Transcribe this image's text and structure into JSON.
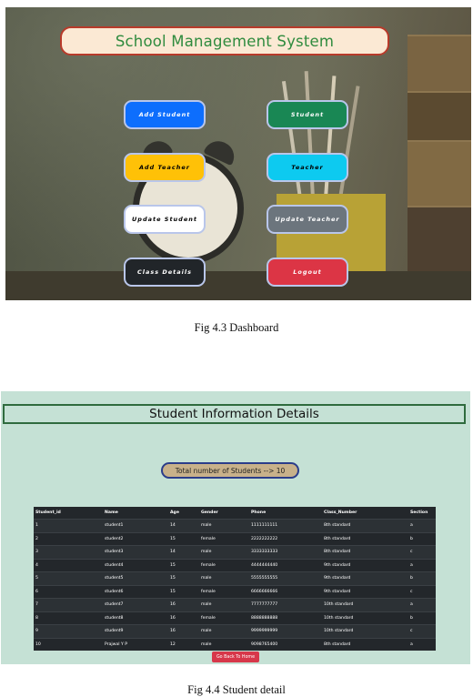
{
  "dashboard": {
    "title": "School Management System",
    "buttons": [
      {
        "label": "Add Student",
        "bg": "#0d6efd",
        "fg": "#ffffff"
      },
      {
        "label": "Student",
        "bg": "#198754",
        "fg": "#ffffff"
      },
      {
        "label": "Add Teacher",
        "bg": "#ffc107",
        "fg": "#000000"
      },
      {
        "label": "Teacher",
        "bg": "#0dcaf0",
        "fg": "#000000"
      },
      {
        "label": "Update Student",
        "bg": "#ffffff",
        "fg": "#000000"
      },
      {
        "label": "Update Teacher",
        "bg": "#6c757d",
        "fg": "#ffffff"
      },
      {
        "label": "Class Details",
        "bg": "#212529",
        "fg": "#ffffff"
      },
      {
        "label": "Logout",
        "bg": "#dc3545",
        "fg": "#ffffff"
      }
    ]
  },
  "caption1": "Fig 4.3 Dashboard",
  "student_detail": {
    "heading": "Student Information Details",
    "total": "Total number of Students --> 10",
    "columns": [
      "Student_id",
      "Name",
      "Age",
      "Gender",
      "Phone",
      "Class_Number",
      "Section"
    ],
    "rows": [
      [
        "1",
        "student1",
        "14",
        "male",
        "1111111111",
        "8th standard",
        "a"
      ],
      [
        "2",
        "student2",
        "15",
        "female",
        "2222222222",
        "8th standard",
        "b"
      ],
      [
        "3",
        "student3",
        "14",
        "male",
        "3333333333",
        "8th standard",
        "c"
      ],
      [
        "4",
        "student4",
        "15",
        "female",
        "4444444440",
        "9th standard",
        "a"
      ],
      [
        "5",
        "student5",
        "15",
        "male",
        "5555555555",
        "9th standard",
        "b"
      ],
      [
        "6",
        "student6",
        "15",
        "female",
        "6666666666",
        "9th standard",
        "c"
      ],
      [
        "7",
        "student7",
        "16",
        "male",
        "7777777777",
        "10th standard",
        "a"
      ],
      [
        "8",
        "student8",
        "16",
        "female",
        "8888888888",
        "10th standard",
        "b"
      ],
      [
        "9",
        "student9",
        "16",
        "male",
        "9999999999",
        "10th standard",
        "c"
      ],
      [
        "10",
        "Prajwal Y P",
        "12",
        "male",
        "9098765400",
        "8th standard",
        "a"
      ]
    ],
    "home_button": "Go Back To Home"
  },
  "caption2": "Fig 4.4 Student detail"
}
